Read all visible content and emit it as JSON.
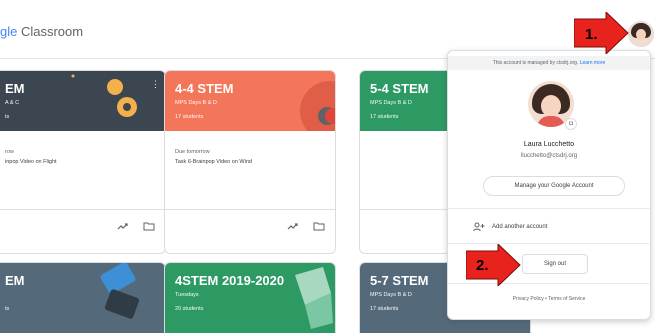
{
  "header": {
    "brand_partial": "gle",
    "brand_rest": " Classroom"
  },
  "cards": [
    {
      "title": "EM",
      "subtitle": "A & C",
      "count": "ts",
      "due": "row",
      "task": "inpop Video on Flight",
      "color": "#3c4650"
    },
    {
      "title": "4-4 STEM",
      "subtitle": "MPS Days B & D",
      "count": "17 students",
      "due": "Due tomorrow",
      "task": "Task 6-Brainpop Video on Wind",
      "color": "#f4765a"
    },
    {
      "title": "5-4 STEM",
      "subtitle": "MPS Days B & D",
      "count": "17 students",
      "due": "",
      "task": "",
      "color": "#2e9a63"
    },
    {
      "title": "EM",
      "subtitle": "",
      "count": "ts",
      "color": "#546a7b"
    },
    {
      "title": "4STEM 2019-2020",
      "subtitle": "Tuesdays",
      "count": "20 students",
      "color": "#2e9a63"
    },
    {
      "title": "5-7 STEM",
      "subtitle": "MPS Days B & D",
      "count": "17 students",
      "color": "#546a7b"
    }
  ],
  "account_menu": {
    "managed_text": "This account is managed by ",
    "managed_domain": "ctsdrj.org",
    "learn_more": "Learn more",
    "name": "Laura Lucchetto",
    "email": "llucchetto@ctsdrj.org",
    "manage_label": "Manage your Google Account",
    "add_account_label": "Add another account",
    "signout_label": "Sign out",
    "privacy_label": "Privacy Policy",
    "footer_sep": "•",
    "terms_label": "Terms of Service"
  },
  "annotations": {
    "step1": "1.",
    "step2": "2."
  },
  "colors": {
    "arrow_red": "#e8231e",
    "link_blue": "#1a73e8"
  },
  "icons": [
    "more-vert-icon",
    "trend-icon",
    "folder-icon",
    "add-person-icon",
    "camera-icon"
  ]
}
